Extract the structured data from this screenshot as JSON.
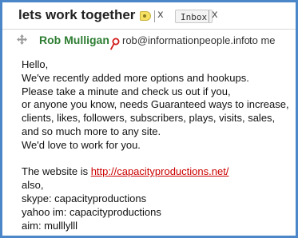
{
  "header": {
    "subject": "lets work together",
    "label_chip": "Inbox",
    "close_glyph": "x",
    "label_tag_color": "#f6e163"
  },
  "message": {
    "sender_name": "Rob Mulligan",
    "sender_email": "rob@informationpeople.info",
    "recipient": "to me",
    "sender_color": "#2e7d32",
    "icons": [
      "move-drag-icon",
      "pin-icon"
    ]
  },
  "body": {
    "greeting": "Hello,",
    "para1": [
      "We've recently added more options and hookups.",
      "Please take a minute and check us out if you,",
      "or anyone you know, needs Guaranteed ways to increase,",
      "clients, likes, followers, subscribers, plays, visits, sales,",
      "and so much more to any site.",
      "We'd love to work for you."
    ],
    "website_prefix": "The website is ",
    "website_url": "http://capacityproductions.net/",
    "para2": [
      "also,",
      "skype: capacityproductions",
      "yahoo im: capacityproductions",
      "aim: mulllylll"
    ],
    "link_color": "#cc0000"
  },
  "frame_color": "#4a86c8"
}
